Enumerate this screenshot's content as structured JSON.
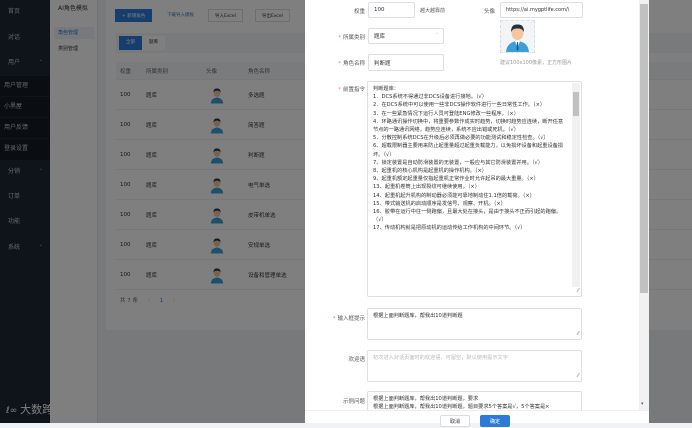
{
  "sidebar": {
    "items": [
      {
        "label": "首页"
      },
      {
        "label": "对话"
      },
      {
        "label": "用户"
      },
      {
        "label": "用户管理"
      },
      {
        "label": "小黑屋"
      },
      {
        "label": "用户反馈"
      },
      {
        "label": "登录设置"
      },
      {
        "label": "分销"
      },
      {
        "label": "订单"
      },
      {
        "label": "功能"
      },
      {
        "label": "系统"
      }
    ],
    "logo": "大数跨境"
  },
  "submenu": {
    "title": "AI角色模拟",
    "items": [
      {
        "label": "角色管理"
      },
      {
        "label": "类别管理"
      }
    ]
  },
  "toolbar": {
    "new": "+ 新增角色",
    "download": "下载导入模板",
    "import": "导入Excel",
    "export": "导出Excel"
  },
  "filter": {
    "all": "全部",
    "bank": "题库"
  },
  "table": {
    "headers": [
      "权重",
      "所属类别",
      "头像",
      "角色名称"
    ],
    "rows": [
      [
        "100",
        "题库",
        "多选题"
      ],
      [
        "100",
        "题库",
        "简答题"
      ],
      [
        "100",
        "题库",
        "判断题"
      ],
      [
        "100",
        "题库",
        "电气单选"
      ],
      [
        "100",
        "题库",
        "皮带机单选"
      ],
      [
        "100",
        "题库",
        "安规单选"
      ],
      [
        "100",
        "题库",
        "设备和管理单选"
      ]
    ],
    "total": "共 7 条",
    "page": "1"
  },
  "modal": {
    "weight_label": "权重",
    "weight_value": "100",
    "weight_hint": "越大越靠前",
    "avatar_label": "头像",
    "avatar_url": "https://ai.mygptlife.com/\\",
    "avatar_hint": "建议100x100像素，正方形图片",
    "category_label": "所属类别",
    "category_value": "题库",
    "name_label": "角色名称",
    "name_value": "判断题",
    "prompt_label": "前置指令",
    "prompt_lines": [
      "判断题库：",
      "1．DCS系统不得通过非DCS设备进行接地。（√）",
      "2．在DCS系统中可以使用一些非DCS操作软件进行一些日常性工作。（×）",
      "3．在一些紧急情况下运行人员可登陆ENG修改一些程序。（×）",
      "4．环路通讯操作切换中，将重要参数作成实时趋势，切换时趋势应连续，断开任意节点的一路通讯网络，趋势应连续，系统不应出错或死机。（√）",
      "5．分散控制系统DCS在升级后必须再做必要的功能测试和稳定性检查。（√）",
      "6、超载限制器主要用来防止起重量超过起重负载能力，以免损坏设备和起重设备损坏。（√）",
      "7、锁定装置是自动防滑装置的无装置，一般应与其它防滑装置并用。（√）",
      "8、起重机的核心机构是起重机的操作机构。（×）",
      "9、起重机额定起重量仅指起重机正常作业时允许起吊的最大重量。（×）",
      "13、起重机卷筒上出现裂纹可继续使用。（×）",
      "14、起重机起升机构的制动器必须能可靠地制动住1.1倍的载荷。（×）",
      "15、带式输送机的启动顺序是发信号、观察、开机。（×）",
      "16、胶带在运行中往一侧跑偏，且最大处在接头，是由于接头不正而引起的跑偏。（√）",
      "17、传动机构就是把原动机的运动传给工作机构的中间环节。（√）"
    ],
    "input_hint_label": "输入框提示",
    "input_hint_value": "根据上面判断题库，帮我出10道判断题",
    "welcome_label": "欢迎语",
    "welcome_placeholder": "初次进入对话页面时的欢迎语，可留空，默认使用提示文字",
    "examples_label": "示例问题",
    "examples_lines": [
      "根据上面判断题库，帮我出10道判断题，要求",
      "根据上面判断题库，帮我出10道判断题，题目要求5个答案是√，5个答案是×"
    ],
    "cancel": "取消",
    "confirm": "确定"
  }
}
